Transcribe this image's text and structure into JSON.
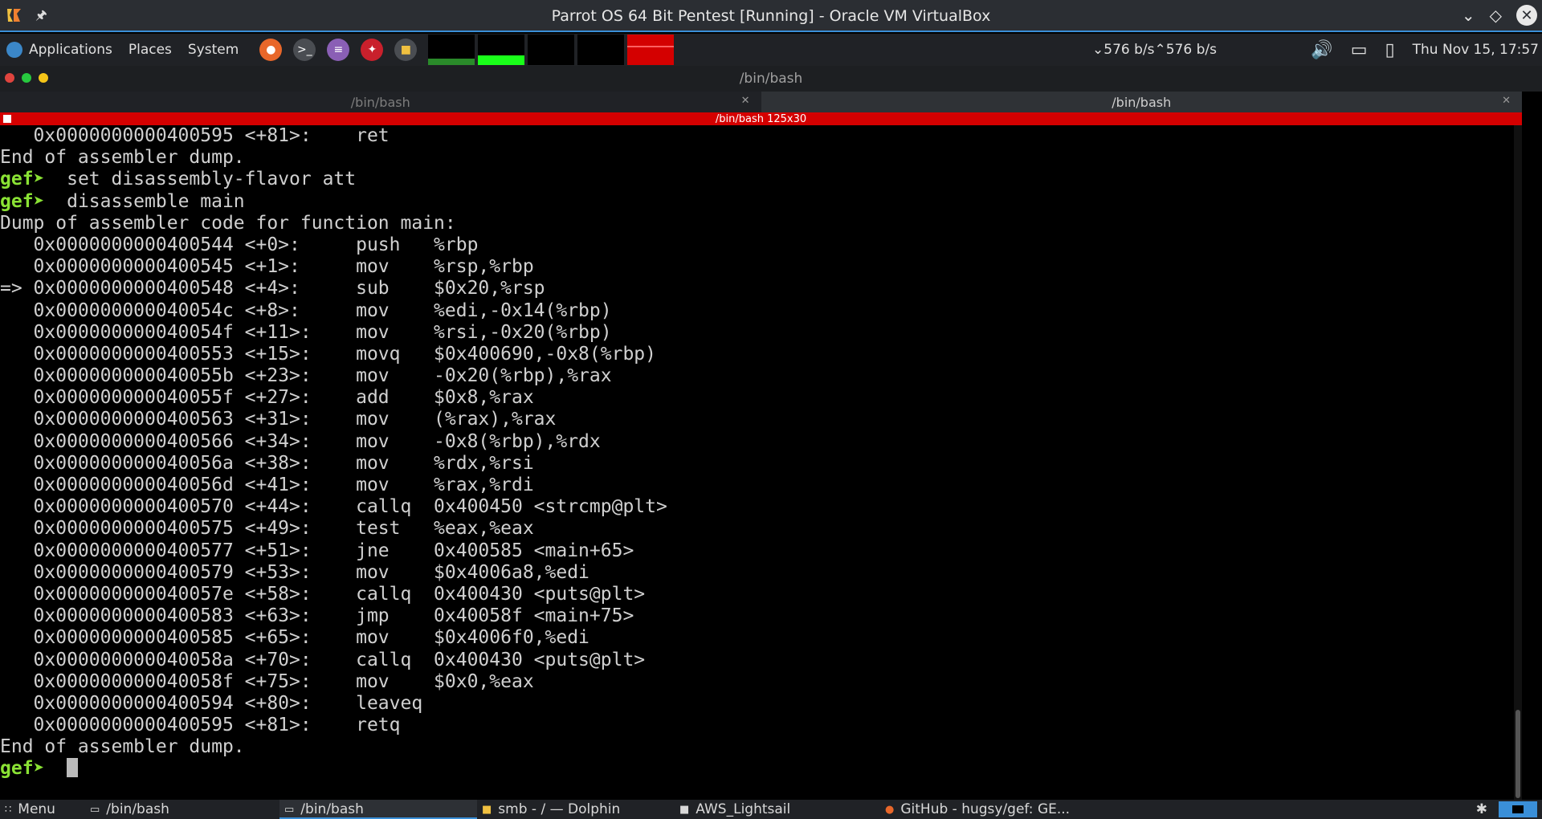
{
  "host_window": {
    "title": "Parrot OS 64 Bit Pentest [Running] - Oracle VM VirtualBox",
    "icons": [
      "virtualbox-logo-icon",
      "pin-icon",
      "minimize-chevron-icon",
      "restore-diamond-icon",
      "close-icon"
    ]
  },
  "guest_panel": {
    "menus": [
      "Applications",
      "Places",
      "System"
    ],
    "launchers": [
      "firefox-icon",
      "terminal-icon",
      "text-editor-icon",
      "parrot-tool-icon",
      "folder-icon"
    ],
    "net_down": "576 b/s",
    "net_up": "576 b/s",
    "clock": "Thu Nov 15, 17:57"
  },
  "terminal": {
    "window_title": "/bin/bash",
    "tabs": [
      {
        "label": "/bin/bash",
        "active": false
      },
      {
        "label": "/bin/bash",
        "active": true
      }
    ],
    "status_bar": "/bin/bash 125x30",
    "lines": [
      {
        "prompt": "",
        "text": "   0x0000000000400595 <+81>:    ret"
      },
      {
        "prompt": "",
        "text": "End of assembler dump."
      },
      {
        "prompt": "gef➤ ",
        "text": " set disassembly-flavor att"
      },
      {
        "prompt": "gef➤ ",
        "text": " disassemble main"
      },
      {
        "prompt": "",
        "text": "Dump of assembler code for function main:"
      },
      {
        "prompt": "",
        "text": "   0x0000000000400544 <+0>:     push   %rbp"
      },
      {
        "prompt": "",
        "text": "   0x0000000000400545 <+1>:     mov    %rsp,%rbp"
      },
      {
        "prompt": "",
        "text": "=> 0x0000000000400548 <+4>:     sub    $0x20,%rsp"
      },
      {
        "prompt": "",
        "text": "   0x000000000040054c <+8>:     mov    %edi,-0x14(%rbp)"
      },
      {
        "prompt": "",
        "text": "   0x000000000040054f <+11>:    mov    %rsi,-0x20(%rbp)"
      },
      {
        "prompt": "",
        "text": "   0x0000000000400553 <+15>:    movq   $0x400690,-0x8(%rbp)"
      },
      {
        "prompt": "",
        "text": "   0x000000000040055b <+23>:    mov    -0x20(%rbp),%rax"
      },
      {
        "prompt": "",
        "text": "   0x000000000040055f <+27>:    add    $0x8,%rax"
      },
      {
        "prompt": "",
        "text": "   0x0000000000400563 <+31>:    mov    (%rax),%rax"
      },
      {
        "prompt": "",
        "text": "   0x0000000000400566 <+34>:    mov    -0x8(%rbp),%rdx"
      },
      {
        "prompt": "",
        "text": "   0x000000000040056a <+38>:    mov    %rdx,%rsi"
      },
      {
        "prompt": "",
        "text": "   0x000000000040056d <+41>:    mov    %rax,%rdi"
      },
      {
        "prompt": "",
        "text": "   0x0000000000400570 <+44>:    callq  0x400450 <strcmp@plt>"
      },
      {
        "prompt": "",
        "text": "   0x0000000000400575 <+49>:    test   %eax,%eax"
      },
      {
        "prompt": "",
        "text": "   0x0000000000400577 <+51>:    jne    0x400585 <main+65>"
      },
      {
        "prompt": "",
        "text": "   0x0000000000400579 <+53>:    mov    $0x4006a8,%edi"
      },
      {
        "prompt": "",
        "text": "   0x000000000040057e <+58>:    callq  0x400430 <puts@plt>"
      },
      {
        "prompt": "",
        "text": "   0x0000000000400583 <+63>:    jmp    0x40058f <main+75>"
      },
      {
        "prompt": "",
        "text": "   0x0000000000400585 <+65>:    mov    $0x4006f0,%edi"
      },
      {
        "prompt": "",
        "text": "   0x000000000040058a <+70>:    callq  0x400430 <puts@plt>"
      },
      {
        "prompt": "",
        "text": "   0x000000000040058f <+75>:    mov    $0x0,%eax"
      },
      {
        "prompt": "",
        "text": "   0x0000000000400594 <+80>:    leaveq"
      },
      {
        "prompt": "",
        "text": "   0x0000000000400595 <+81>:    retq"
      },
      {
        "prompt": "",
        "text": "End of assembler dump."
      },
      {
        "prompt": "gef➤ ",
        "text": " "
      }
    ]
  },
  "taskbar": {
    "menu_label": "Menu",
    "tasks": [
      {
        "label": "/bin/bash",
        "icon": "terminal-icon",
        "active": false
      },
      {
        "label": "/bin/bash",
        "icon": "terminal-icon",
        "active": true
      },
      {
        "label": "smb - / — Dolphin",
        "icon": "dolphin-icon",
        "active": false
      },
      {
        "label": "AWS_Lightsail",
        "icon": "folder-icon",
        "active": false
      },
      {
        "label": "GitHub - hugsy/gef: GE...",
        "icon": "firefox-icon",
        "active": false
      }
    ]
  },
  "colors": {
    "prompt": "#8ae234",
    "status_bar": "#d40000",
    "accent": "#3a8fd8"
  }
}
